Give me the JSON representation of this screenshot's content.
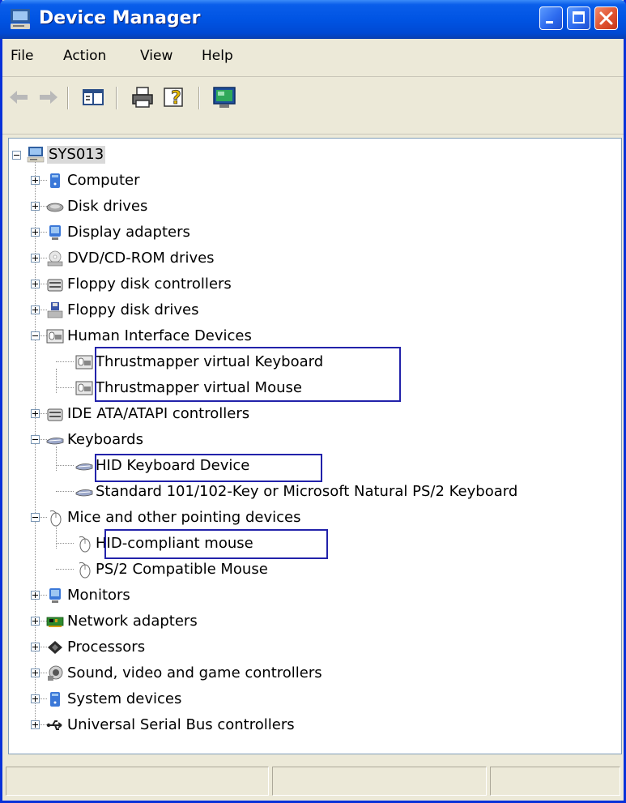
{
  "window": {
    "title": "Device Manager",
    "app_icon": "computer-icon",
    "controls": [
      "minimize-button",
      "maximize-button",
      "close-button"
    ]
  },
  "menubar": {
    "items": [
      "File",
      "Action",
      "View",
      "Help"
    ]
  },
  "toolbar": {
    "buttons": [
      "back-arrow-icon",
      "forward-arrow-icon",
      "show-hide-console-tree-icon",
      "print-icon",
      "help-icon",
      "scan-hardware-icon"
    ]
  },
  "tree": {
    "root": {
      "label": "SYS013",
      "icon": "computer-icon",
      "expanded": true,
      "selected": true
    },
    "nodes": [
      {
        "label": "Computer",
        "icon": "computer-icon",
        "expanded": false
      },
      {
        "label": "Disk drives",
        "icon": "disk-drive-icon",
        "expanded": false
      },
      {
        "label": "Display adapters",
        "icon": "display-adapter-icon",
        "expanded": false
      },
      {
        "label": "DVD/CD-ROM drives",
        "icon": "cdrom-drive-icon",
        "expanded": false
      },
      {
        "label": "Floppy disk controllers",
        "icon": "controller-icon",
        "expanded": false
      },
      {
        "label": "Floppy disk drives",
        "icon": "floppy-drive-icon",
        "expanded": false
      },
      {
        "label": "Human Interface Devices",
        "icon": "hid-device-icon",
        "expanded": true,
        "children": [
          {
            "label": "Thrustmapper virtual Keyboard",
            "icon": "hid-device-icon",
            "highlighted": true
          },
          {
            "label": "Thrustmapper virtual Mouse",
            "icon": "hid-device-icon",
            "highlighted": true
          }
        ]
      },
      {
        "label": "IDE ATA/ATAPI controllers",
        "icon": "controller-icon",
        "expanded": false
      },
      {
        "label": "Keyboards",
        "icon": "keyboard-icon",
        "expanded": true,
        "children": [
          {
            "label": "HID Keyboard Device",
            "icon": "keyboard-icon",
            "highlighted": true
          },
          {
            "label": "Standard 101/102-Key or Microsoft Natural PS/2 Keyboard",
            "icon": "keyboard-icon"
          }
        ]
      },
      {
        "label": "Mice and other pointing devices",
        "icon": "mouse-icon",
        "expanded": true,
        "children": [
          {
            "label": "HID-compliant mouse",
            "icon": "mouse-icon",
            "highlighted": true
          },
          {
            "label": "PS/2 Compatible Mouse",
            "icon": "mouse-icon"
          }
        ]
      },
      {
        "label": "Monitors",
        "icon": "monitor-icon",
        "expanded": false
      },
      {
        "label": "Network adapters",
        "icon": "network-adapter-icon",
        "expanded": false
      },
      {
        "label": "Processors",
        "icon": "processor-icon",
        "expanded": false
      },
      {
        "label": "Sound, video and game controllers",
        "icon": "sound-icon",
        "expanded": false
      },
      {
        "label": "System devices",
        "icon": "system-device-icon",
        "expanded": false
      },
      {
        "label": "Universal Serial Bus controllers",
        "icon": "usb-icon",
        "expanded": false
      }
    ]
  },
  "statusbar": {
    "panels": [
      "",
      "",
      ""
    ]
  },
  "colors": {
    "titlebar": "#0054E3",
    "window_border": "#0831D9",
    "face": "#ECE9D8",
    "highlight_box": "#2222AA",
    "close_button": "#E0522F"
  }
}
